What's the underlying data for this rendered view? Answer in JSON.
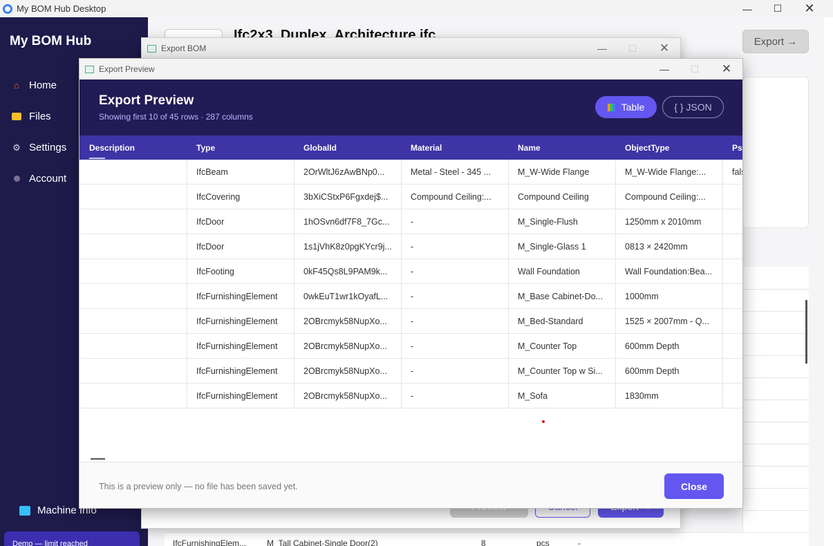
{
  "window": {
    "title": "My BOM Hub Desktop"
  },
  "sidebar": {
    "brand": "My BOM Hub",
    "items": [
      {
        "label": "Home",
        "icon": "home-icon"
      },
      {
        "label": "Files",
        "icon": "folder-icon"
      },
      {
        "label": "Settings",
        "icon": "gear-icon"
      },
      {
        "label": "Account",
        "icon": "user-icon"
      }
    ],
    "machine_info": "Machine Info",
    "demo_badge": "Demo — limit reached"
  },
  "main": {
    "file_title": "Ifc2x3_Duplex_Architecture.ifc",
    "export_button": "Export →",
    "bottom_row": {
      "type": "IfcFurnishingElem...",
      "name": "M_Tall Cabinet-Single Door(2)",
      "qty": "8",
      "unit": "pcs",
      "extra": "-"
    }
  },
  "export_bom_dialog": {
    "title": "Export BOM",
    "preview_button": "Preview",
    "cancel_button": "Cancel",
    "export_button": "Export →"
  },
  "preview_dialog": {
    "window_title": "Export Preview",
    "title": "Export Preview",
    "subtitle": "Showing first 10 of 45 rows · 287 columns",
    "table_button": "Table",
    "json_button": "{ } JSON",
    "columns": [
      "Description",
      "Type",
      "GlobalId",
      "Material",
      "Name",
      "ObjectType",
      "Ps"
    ],
    "rows": [
      [
        "",
        "IfcBeam",
        "2OrWltJ6zAwBNp0...",
        "Metal - Steel - 345 ...",
        "M_W-Wide Flange",
        "M_W-Wide Flange:...",
        "fals"
      ],
      [
        "",
        "IfcCovering",
        "3bXiCStxP6Fgxdej$...",
        "Compound Ceiling:...",
        "Compound Ceiling",
        "Compound Ceiling:...",
        ""
      ],
      [
        "",
        "IfcDoor",
        "1hOSvn6df7F8_7Gc...",
        "-",
        "M_Single-Flush",
        "1250mm x 2010mm",
        ""
      ],
      [
        "",
        "IfcDoor",
        "1s1jVhK8z0pgKYcr9j...",
        "-",
        "M_Single-Glass 1",
        "0813 × 2420mm",
        ""
      ],
      [
        "",
        "IfcFooting",
        "0kF45Qs8L9PAM9k...",
        "-",
        "Wall Foundation",
        "Wall Foundation:Bea...",
        ""
      ],
      [
        "",
        "IfcFurnishingElement",
        "0wkEuT1wr1kOyafL...",
        "-",
        "M_Base Cabinet-Do...",
        "1000mm",
        ""
      ],
      [
        "",
        "IfcFurnishingElement",
        "2OBrcmyk58NupXo...",
        "-",
        "M_Bed-Standard",
        "1525 × 2007mm - Q...",
        ""
      ],
      [
        "",
        "IfcFurnishingElement",
        "2OBrcmyk58NupXo...",
        "-",
        "M_Counter Top",
        "600mm Depth",
        ""
      ],
      [
        "",
        "IfcFurnishingElement",
        "2OBrcmyk58NupXo...",
        "-",
        "M_Counter Top w Si...",
        "600mm Depth",
        ""
      ],
      [
        "",
        "IfcFurnishingElement",
        "2OBrcmyk58NupXo...",
        "-",
        "M_Sofa",
        "1830mm",
        ""
      ]
    ],
    "footer_note": "This is a preview only — no file has been saved yet.",
    "close_button": "Close"
  },
  "colors": {
    "sidebar_bg": "#1e1b4b",
    "header_bg": "#221b55",
    "table_head_bg": "#3d34a5",
    "accent": "#6357f0"
  }
}
